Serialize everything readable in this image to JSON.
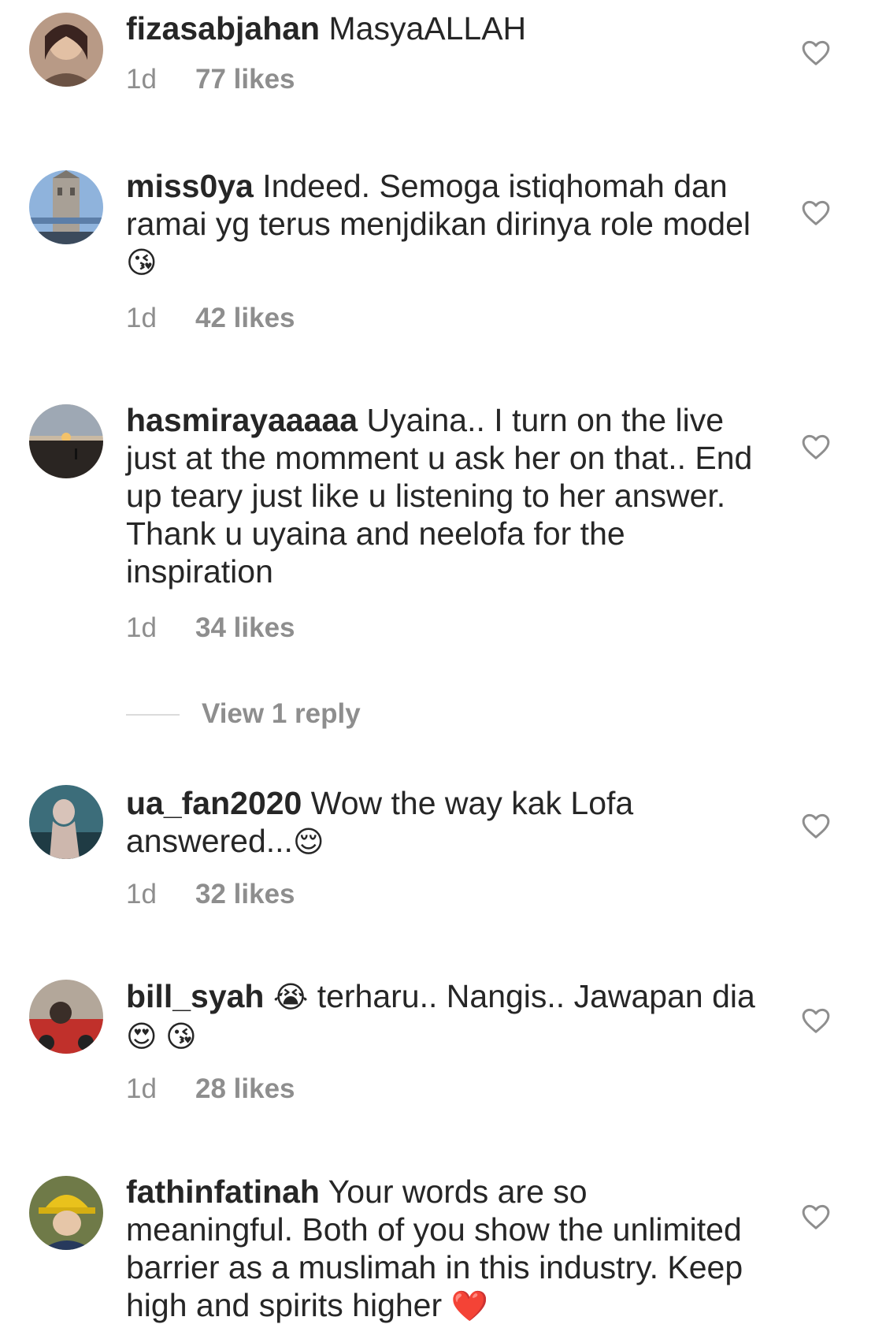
{
  "comments": [
    {
      "username": "fizasabjahan",
      "text": "MasyaALLAH",
      "emoji": "",
      "time": "1d",
      "likes": "77 likes",
      "avatar_icon": "user-avatar-portrait"
    },
    {
      "username": "miss0ya",
      "text": "Indeed. Semoga istiqhomah dan ramai yg terus menjdikan dirinya role model",
      "emoji": "😘",
      "time": "1d",
      "likes": "42 likes",
      "avatar_icon": "user-avatar-tower-bridge"
    },
    {
      "username": "hasmirayaaaaa",
      "text": "Uyaina.. I turn on the live just at the momment u ask her on that.. End up teary just like u listening to her answer. Thank u uyaina and neelofa for the inspiration",
      "emoji": "",
      "time": "1d",
      "likes": "34 likes",
      "avatar_icon": "user-avatar-sunset"
    },
    {
      "username": "ua_fan2020",
      "text": "Wow the way kak Lofa answered...",
      "emoji": "😌",
      "time": "1d",
      "likes": "32 likes",
      "avatar_icon": "user-avatar-hijab"
    },
    {
      "username": "bill_syah",
      "text_pre_emoji": "😭",
      "text": "terharu.. Nangis.. Jawapan dia",
      "emoji": "😍 😘",
      "time": "1d",
      "likes": "28 likes",
      "avatar_icon": "user-avatar-car"
    },
    {
      "username": "fathinfatinah",
      "text": "Your words are so meaningful. Both of you show the unlimited barrier as a muslimah in this industry. Keep high and spirits higher",
      "emoji": "❤️",
      "time": "",
      "likes": "",
      "avatar_icon": "user-avatar-yellow-hat"
    }
  ],
  "view_replies_label": "View 1 reply",
  "icons": {
    "like": "heart-outline-icon"
  },
  "colors": {
    "text": "#262626",
    "secondary": "#8e8e8e",
    "divider": "#dbdbdb"
  }
}
